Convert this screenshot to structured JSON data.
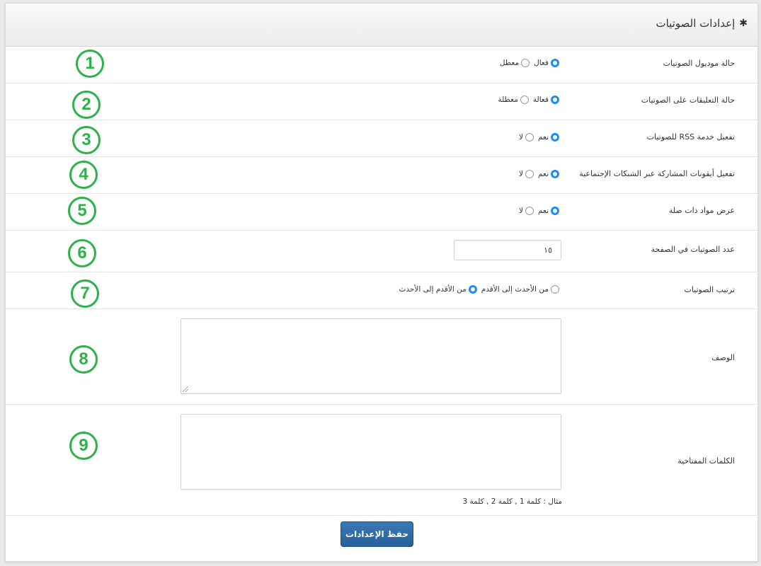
{
  "header": {
    "title": "إعدادات الصوتيات",
    "icon": "gear-icon"
  },
  "settings": [
    {
      "label": "حالة موديول الصوتيات",
      "options": [
        "فعال",
        "معطل"
      ],
      "selected": 0,
      "badge": "1"
    },
    {
      "label": "حالة التعليقات على الصوتيات",
      "options": [
        "فعالة",
        "معطلة"
      ],
      "selected": 0,
      "badge": "2"
    },
    {
      "label": "تفعيل خدمة RSS للصوتيات",
      "options": [
        "نعم",
        "لا"
      ],
      "selected": 0,
      "badge": "3"
    },
    {
      "label": "تفعيل أيقونات المشاركة عبر الشبكات الإجتماعية",
      "options": [
        "نعم",
        "لا"
      ],
      "selected": 0,
      "badge": "4"
    },
    {
      "label": "عرض مواد ذات صلة",
      "options": [
        "نعم",
        "لا"
      ],
      "selected": 0,
      "badge": "5"
    }
  ],
  "per_page": {
    "label": "عدد الصوتيات في الصفحة",
    "value": "١٥",
    "badge": "6"
  },
  "order": {
    "label": "ترتيب الصوتيات",
    "options": [
      "من الأحدث إلى الأقدم",
      "من الأقدم إلى الأحدث"
    ],
    "selected": 1,
    "badge": "7"
  },
  "description": {
    "label": "الوصف",
    "value": "",
    "badge": "8"
  },
  "keywords": {
    "label": "الكلمات المفتاحية",
    "value": "",
    "hint": "مثال : كلمة 1 , كلمة 2 , كلمة 3",
    "badge": "9"
  },
  "save_label": "حفظ الإعدادات",
  "colors": {
    "badge": "#2cb24a",
    "radio_selected": "#1a8cff",
    "button": "#2f6ca8"
  }
}
